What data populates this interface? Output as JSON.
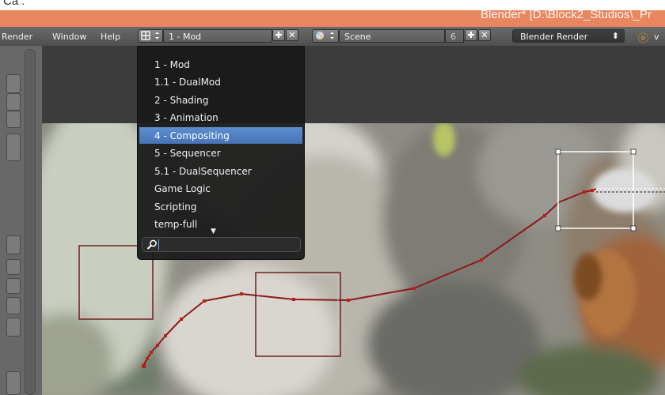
{
  "caption": "Ca :",
  "window_title": "Blender* [D:\\Block2_Studios\\_Pr",
  "menu": {
    "render": "Render",
    "window": "Window",
    "help": "Help"
  },
  "screen_layout": {
    "value": "1 - Mod",
    "icon": "screen-layout-icon"
  },
  "scene": {
    "value": "Scene",
    "count": "6",
    "icon": "scene-icon"
  },
  "render_engine": {
    "value": "Blender Render"
  },
  "extra_header_text": "v",
  "layout_dropdown": {
    "items": [
      "1 - Mod",
      "1.1 - DualMod",
      "2 - Shading",
      "3 - Animation",
      "4 - Compositing",
      "5 - Sequencer",
      "5.1 - DualSequencer",
      "Game Logic",
      "Scripting",
      "temp-full"
    ],
    "selected_index": 4,
    "search_value": "",
    "more_indicator": "▼"
  },
  "colors": {
    "title_bar": "#e8865f",
    "header": "#5a5a5a",
    "highlight": "#5680c2",
    "curve": "#8b1a1a"
  }
}
